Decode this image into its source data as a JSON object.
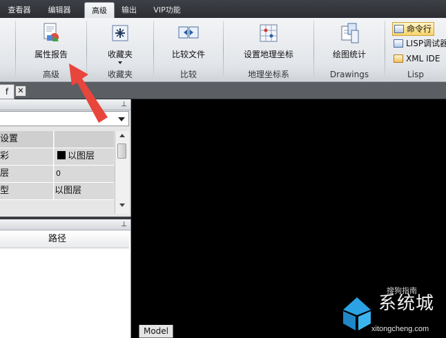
{
  "menu": {
    "tabs": [
      {
        "label": "查看器"
      },
      {
        "label": "编辑器"
      },
      {
        "label": "高级",
        "active": true
      },
      {
        "label": "输出"
      },
      {
        "label": "VIP功能"
      }
    ]
  },
  "ribbon": {
    "groups": [
      {
        "label": "",
        "buttons": [
          {
            "label": "",
            "icon": "cut-off-icon"
          }
        ]
      },
      {
        "label": "高级",
        "buttons": [
          {
            "label": "属性报告",
            "icon": "attribute-report-icon"
          }
        ]
      },
      {
        "label": "收藏夹",
        "buttons": [
          {
            "label": "收藏夹",
            "icon": "favorites-icon",
            "dropdown": true
          }
        ]
      },
      {
        "label": "比较",
        "buttons": [
          {
            "label": "比较文件",
            "icon": "compare-files-icon"
          }
        ]
      },
      {
        "label": "地理坐标系",
        "buttons": [
          {
            "label": "设置地理坐标",
            "icon": "geo-coordinate-icon"
          }
        ]
      },
      {
        "label": "Drawings",
        "buttons": [
          {
            "label": "绘图统计",
            "icon": "drawing-statistics-icon"
          }
        ]
      },
      {
        "label": "Lisp",
        "buttons": [
          {
            "label": "命令行",
            "icon": "command-line-icon",
            "highlighted": true
          },
          {
            "label": "LISP调试器",
            "icon": "lisp-debugger-icon"
          },
          {
            "label": "XML IDE",
            "icon": "xml-ide-icon"
          }
        ]
      }
    ]
  },
  "document": {
    "tab_label": "f",
    "close_glyph": "✕"
  },
  "properties_panel": {
    "pin_glyph": "⊥",
    "selected": "",
    "rows": [
      {
        "key": "设置",
        "value": "",
        "header": true
      },
      {
        "key": "彩",
        "value": "以图层",
        "swatch": "#000000"
      },
      {
        "key": "层",
        "value": "0"
      },
      {
        "key": "型",
        "value": "以图层"
      }
    ]
  },
  "files_panel": {
    "pin_glyph": "⊥",
    "columns": [
      "路径"
    ]
  },
  "canvas": {
    "layout_tab": "Model",
    "background": "#000000"
  },
  "annotation": {
    "color": "#e8453c"
  },
  "watermark": {
    "name": "系统城",
    "sub": "搜狗指南",
    "url": "xitongcheng.com"
  }
}
